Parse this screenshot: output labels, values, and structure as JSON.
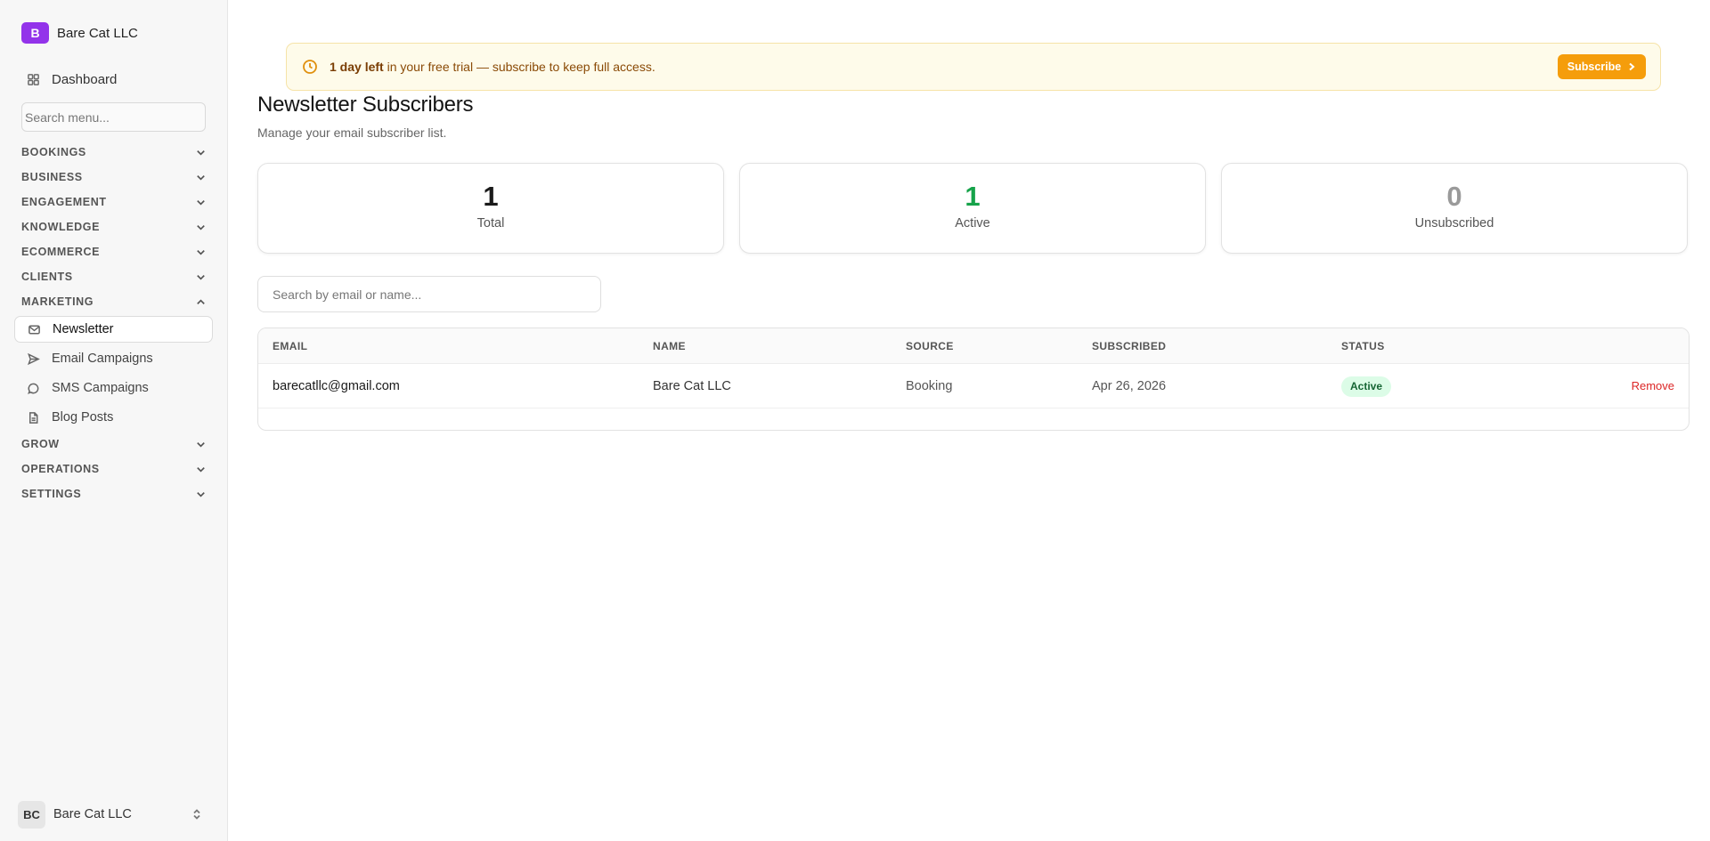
{
  "sidebar": {
    "brand_initial": "B",
    "brand_name": "Bare Cat LLC",
    "dashboard_label": "Dashboard",
    "search_placeholder": "Search menu...",
    "sections": {
      "bookings": "BOOKINGS",
      "business": "BUSINESS",
      "engagement": "ENGAGEMENT",
      "knowledge": "KNOWLEDGE",
      "ecommerce": "ECOMMERCE",
      "clients": "CLIENTS",
      "marketing": "MARKETING",
      "grow": "GROW",
      "operations": "OPERATIONS",
      "settings": "SETTINGS"
    },
    "marketing_items": {
      "newsletter": "Newsletter",
      "email_campaigns": "Email Campaigns",
      "sms_campaigns": "SMS Campaigns",
      "blog_posts": "Blog Posts"
    },
    "user": {
      "initials": "BC",
      "name": "Bare Cat LLC"
    }
  },
  "banner": {
    "bold": "1 day left",
    "text": " in your free trial — subscribe to keep full access.",
    "button": "Subscribe"
  },
  "page": {
    "title": "Newsletter Subscribers",
    "subtitle": "Manage your email subscriber list."
  },
  "stats": {
    "total": {
      "value": "1",
      "label": "Total"
    },
    "active": {
      "value": "1",
      "label": "Active"
    },
    "unsubscribed": {
      "value": "0",
      "label": "Unsubscribed"
    }
  },
  "table": {
    "search_placeholder": "Search by email or name...",
    "headers": {
      "email": "EMAIL",
      "name": "NAME",
      "source": "SOURCE",
      "subscribed": "SUBSCRIBED",
      "status": "STATUS"
    },
    "rows": [
      {
        "email": "barecatllc@gmail.com",
        "name": "Bare Cat LLC",
        "source": "Booking",
        "subscribed": "Apr 26, 2026",
        "status": "Active",
        "action": "Remove"
      }
    ]
  },
  "colors": {
    "brand": "#9333ea",
    "accent_orange": "#f59d0b",
    "active_green": "#16a34a",
    "unsub_gray": "#9a9a9a",
    "remove_red": "#dc2626"
  }
}
